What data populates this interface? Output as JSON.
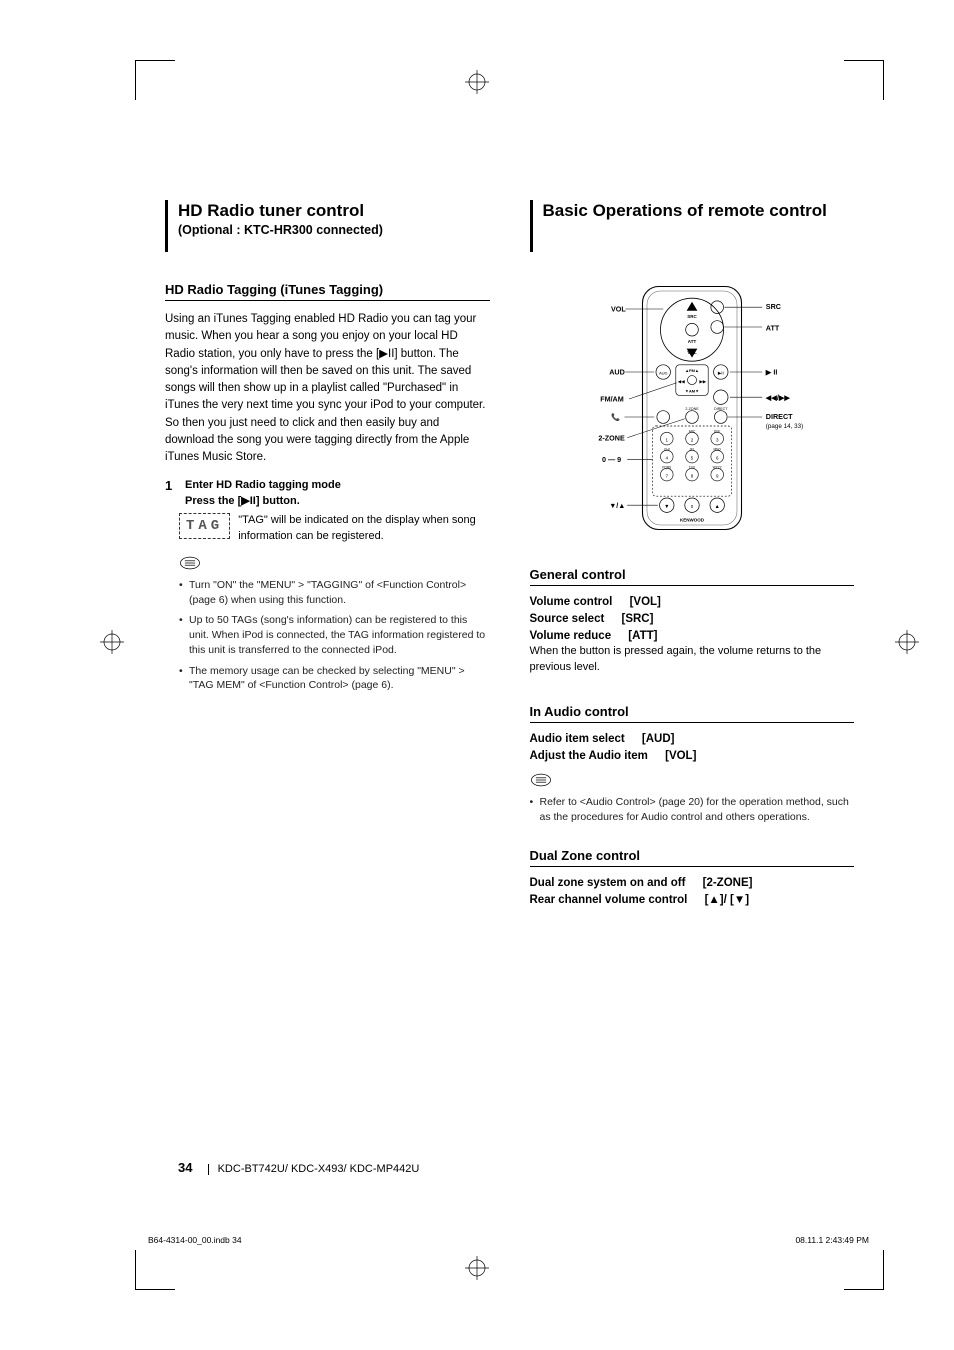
{
  "left": {
    "title": "HD Radio tuner control",
    "subtitle": "(Optional : KTC-HR300 connected)",
    "section_heading": "HD Radio Tagging (iTunes Tagging)",
    "intro": "Using an iTunes Tagging enabled HD Radio you can tag your music. When you hear a song you enjoy on your local HD Radio station, you only have to press the [▶II] button. The song's information will then be saved on this unit. The saved songs will then show up in a playlist called \"Purchased\" in iTunes the very next time you sync your iPod to your computer. So then you just need to click and then easily buy and download the song you were tagging directly from the Apple iTunes Music Store.",
    "step_num": "1",
    "step_head": "Enter HD Radio tagging mode",
    "step_text": "Press the [▶II] button.",
    "indicator_box": "TAG",
    "indicator_text": "\"TAG\" will be indicated on the display when song information can be registered.",
    "notes": [
      "Turn \"ON\" the \"MENU\" > \"TAGGING\" of <Function Control> (page 6) when using this function.",
      "Up to 50 TAGs (song's information) can be registered to this unit. When iPod is connected, the TAG information registered to this unit is transferred to the connected iPod.",
      "The memory usage can be checked by selecting \"MENU\" > \"TAG MEM\" of <Function Control> (page 6)."
    ]
  },
  "right": {
    "title": "Basic Operations of remote control",
    "remote_labels": {
      "vol": "VOL",
      "src": "SRC",
      "att": "ATT",
      "aud": "AUD",
      "play": "▶ II",
      "fmam": "FM/AM",
      "phone": "📞",
      "direct": "DIRECT",
      "direct_ref": "(page 14, 33)",
      "twozone": "2-ZONE",
      "digits": "0 — 9",
      "updown": "▼/▲",
      "seek": "◀◀/▶▶",
      "brand": "KENWOOD"
    },
    "general": {
      "heading": "General control",
      "vol_label": "Volume control",
      "vol_key": "[VOL]",
      "src_label": "Source select",
      "src_key": "[SRC]",
      "att_label": "Volume reduce",
      "att_key": "[ATT]",
      "att_desc": "When the button is pressed again, the volume returns to the previous level."
    },
    "audio": {
      "heading": "In Audio control",
      "item_label": "Audio item select",
      "item_key": "[AUD]",
      "adj_label": "Adjust the Audio item",
      "adj_key": "[VOL]",
      "note": "Refer to <Audio Control> (page 20) for the operation method, such as the procedures for Audio control and others operations."
    },
    "dual": {
      "heading": "Dual Zone control",
      "on_label": "Dual zone system on and off",
      "on_key": "[2-ZONE]",
      "rear_label": "Rear channel volume control",
      "rear_key": "[▲]/ [▼]"
    }
  },
  "footer": {
    "page": "34",
    "models": "KDC-BT742U/ KDC-X493/ KDC-MP442U",
    "file": "B64-4314-00_00.indb   34",
    "timestamp": "08.11.1   2:43:49 PM"
  }
}
